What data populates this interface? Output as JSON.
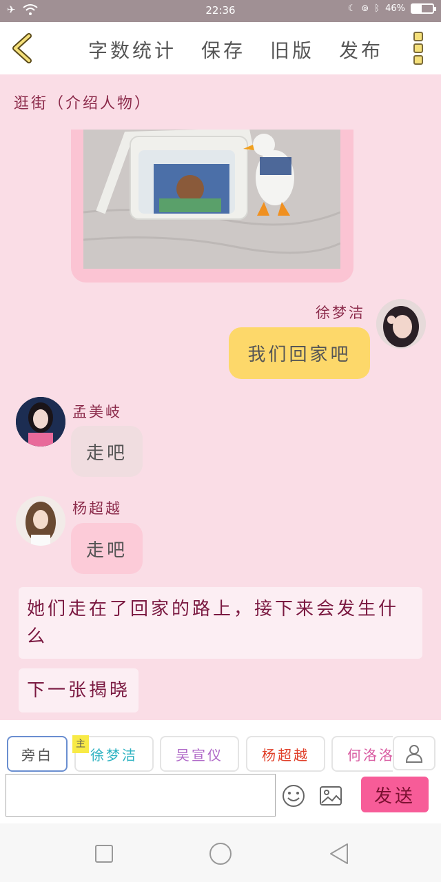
{
  "status_bar": {
    "time": "22:36",
    "battery": "46%",
    "battery_level": 0.46
  },
  "header": {
    "actions": [
      "字数统计",
      "保存",
      "旧版",
      "发布"
    ]
  },
  "scene_title": "逛街（介绍人物）",
  "messages": [
    {
      "side": "right",
      "name": "徐梦洁",
      "text": "我们回家吧"
    },
    {
      "side": "left",
      "name": "孟美岐",
      "text": "走吧"
    },
    {
      "side": "left",
      "name": "杨超越",
      "text": "走吧"
    }
  ],
  "narrations": [
    "她们走在了回家的路上，接下来会发生什么",
    "下一张揭晓"
  ],
  "composer": {
    "host_badge": "主",
    "char_tabs": [
      {
        "label": "旁白",
        "color": "#555555"
      },
      {
        "label": "徐梦洁",
        "color": "#2fb3c2"
      },
      {
        "label": "吴宣仪",
        "color": "#b06ac8"
      },
      {
        "label": "杨超越",
        "color": "#e0402a"
      },
      {
        "label": "何洛洛",
        "color": "#d85aa0"
      }
    ],
    "input_value": "",
    "send_label": "发送"
  },
  "colors": {
    "background": "#fadde6",
    "accent": "#f75c98",
    "self_bubble": "#fdd86a",
    "bubble_mengmeiqi": "#f0dde0",
    "bubble_yangchaoyue": "#fccbd8"
  }
}
